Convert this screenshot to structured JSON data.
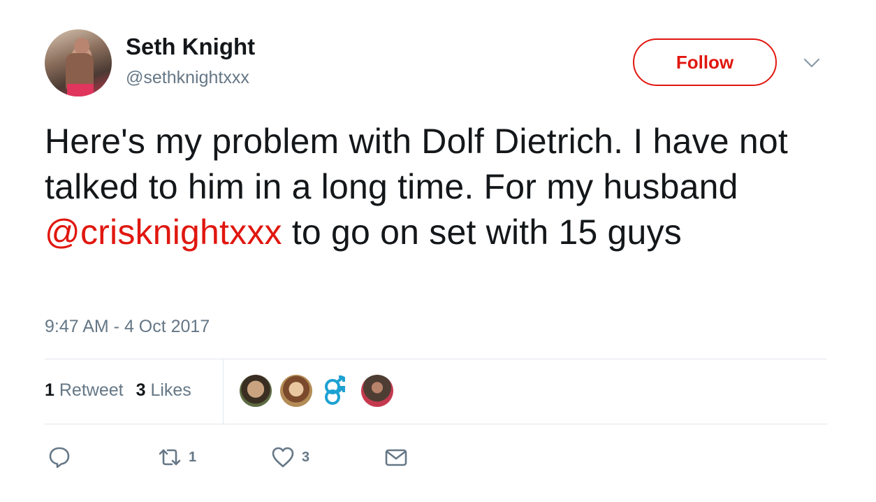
{
  "user": {
    "display_name": "Seth Knight",
    "handle": "@sethknightxxx"
  },
  "follow_label": "Follow",
  "tweet": {
    "text_before": "Here's my problem with Dolf Dietrich.  I have not talked to him in a long time.  For my husband ",
    "mention": "@crisknightxxx",
    "text_after": " to go on set with 15 guys",
    "timestamp": "9:47 AM - 4 Oct 2017"
  },
  "stats": {
    "retweets_count": "1",
    "retweets_label": "Retweet",
    "likes_count": "3",
    "likes_label": "Likes"
  },
  "actions": {
    "retweet_count": "1",
    "like_count": "3"
  },
  "colors": {
    "accent": "#e0170f",
    "muted": "#657786",
    "text": "#14171a",
    "divider": "#e1e8ed"
  }
}
